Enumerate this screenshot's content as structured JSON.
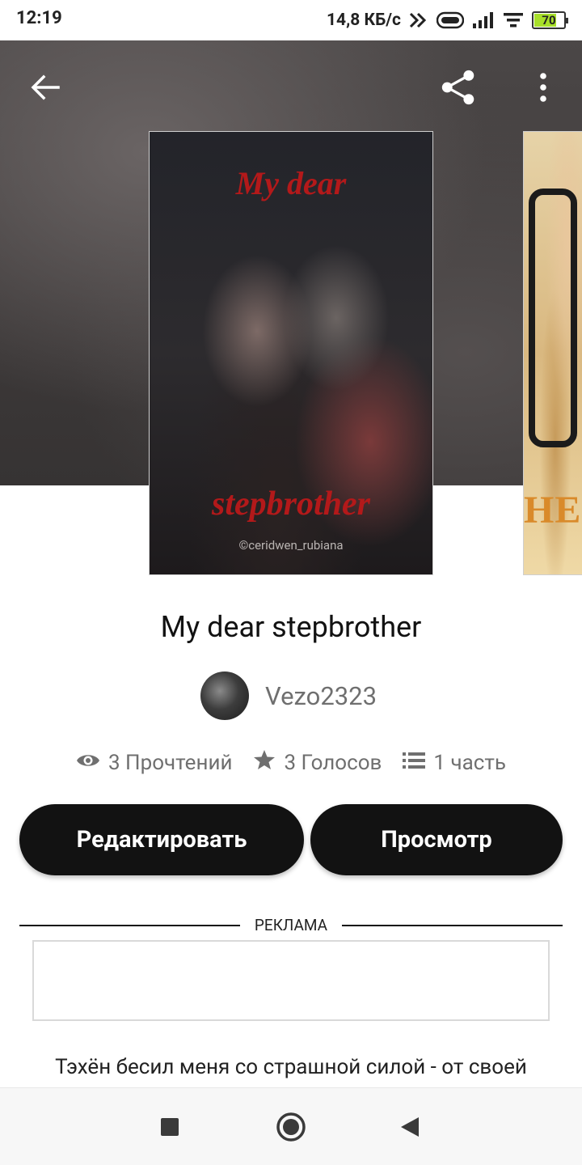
{
  "status_bar": {
    "time": "12:19",
    "network_speed": "14,8 КБ/с",
    "battery_percent": "70",
    "battery_level": 0.7,
    "icons": [
      "data-arrows-icon",
      "vowifi-icon",
      "signal-icon",
      "wifi-icon",
      "battery-icon"
    ]
  },
  "toolbar": {
    "back_icon": "arrow-left-icon",
    "share_icon": "share-icon",
    "more_icon": "more-vertical-icon"
  },
  "cover": {
    "title_top": "My dear",
    "title_bottom": "stepbrother",
    "credit": "©ceridwen_rubiana",
    "next_cover_text": "HE"
  },
  "book": {
    "title": "My dear stepbrother",
    "author": "Vezo2323"
  },
  "stats": {
    "reads": "3 Прочтений",
    "votes": "3 Голосов",
    "parts": "1 часть"
  },
  "buttons": {
    "edit": "Редактировать",
    "view": "Просмотр"
  },
  "ad": {
    "label": "РЕКЛАМА"
  },
  "description": "Тэхён бесил меня со страшной силой - от своей",
  "colors": {
    "button_bg": "#121212",
    "accent_cover_red": "#b3191a",
    "battery_fill": "#a8e02a"
  }
}
